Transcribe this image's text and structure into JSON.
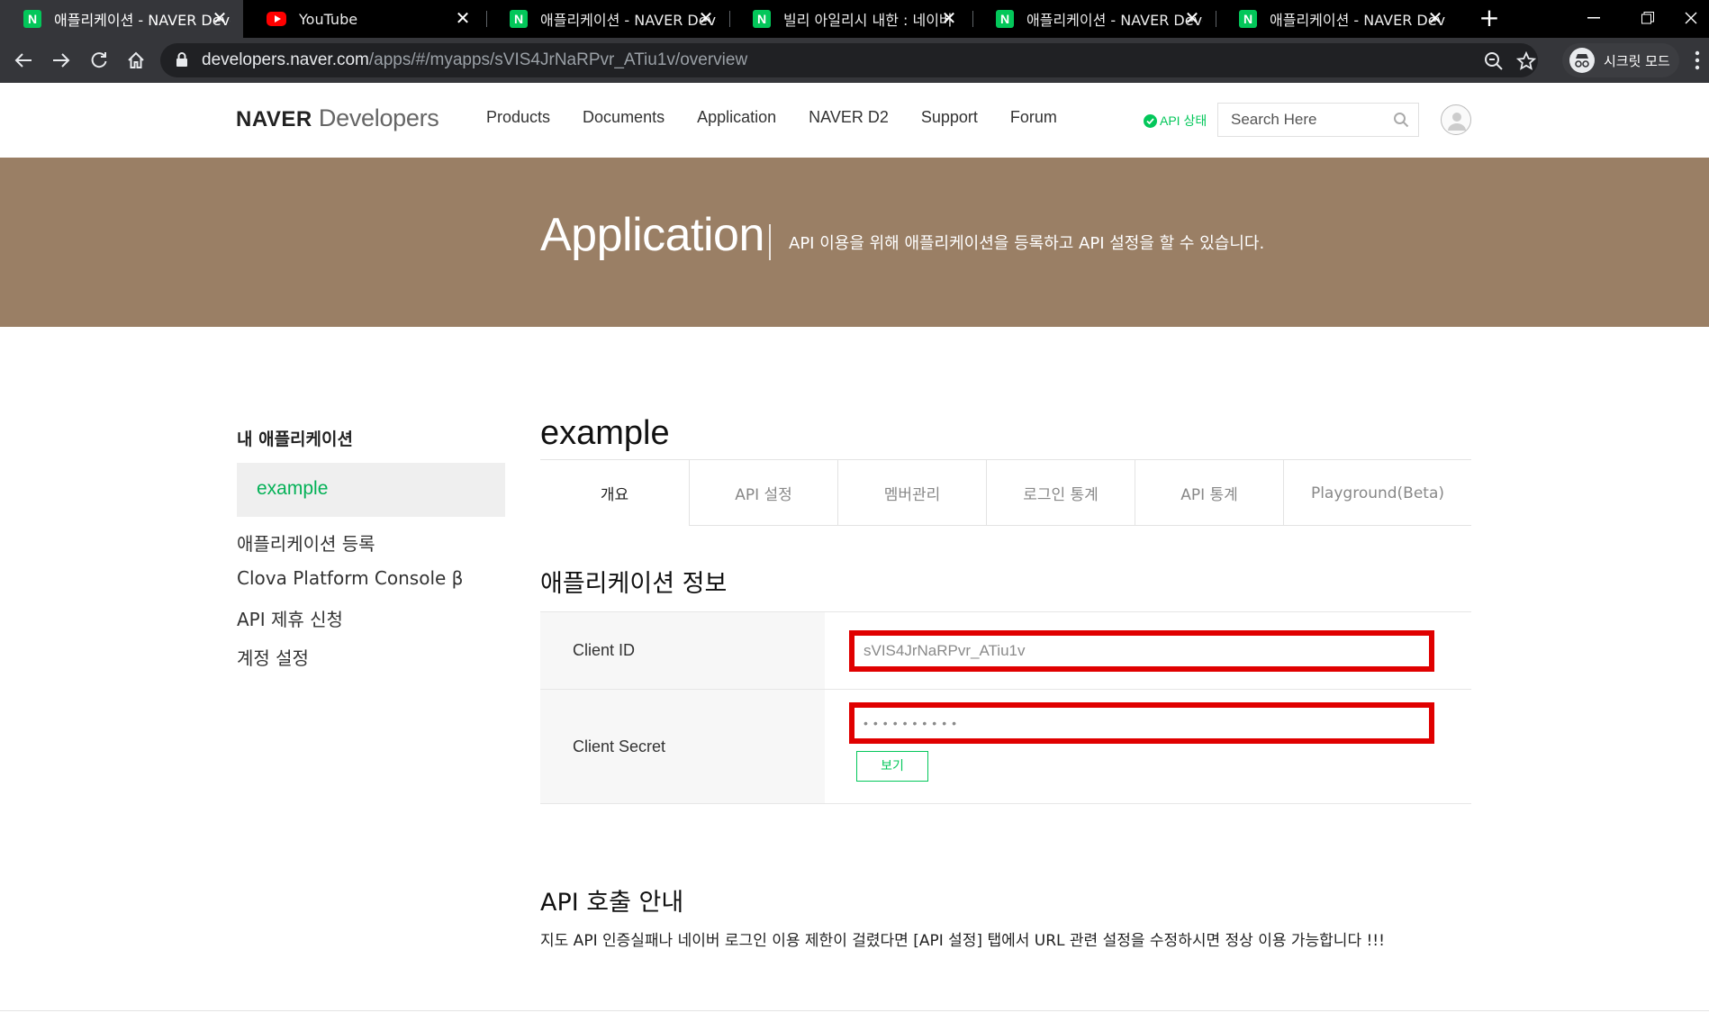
{
  "browser": {
    "tabs": [
      {
        "title": "애플리케이션 - NAVER Developers",
        "favicon": "naver-icon",
        "active": true
      },
      {
        "title": "YouTube",
        "favicon": "youtube-icon",
        "active": false
      },
      {
        "title": "애플리케이션 - NAVER Developers",
        "favicon": "naver-icon",
        "active": false
      },
      {
        "title": "빌리 아일리시 내한 : 네이버",
        "favicon": "naver-icon",
        "active": false
      },
      {
        "title": "애플리케이션 - NAVER Developers",
        "favicon": "naver-icon",
        "active": false
      },
      {
        "title": "애플리케이션 - NAVER Developers",
        "favicon": "naver-icon",
        "active": false
      }
    ],
    "url_host": "developers.naver.com",
    "url_path": "/apps/#/myapps/sVIS4JrNaRPvr_ATiu1v/overview",
    "incognito_label": "시크릿 모드",
    "new_tab_symbol": "+"
  },
  "header": {
    "logo_bold": "NAVER",
    "logo_light": " Developers",
    "nav": [
      "Products",
      "Documents",
      "Application",
      "NAVER D2",
      "Support",
      "Forum"
    ],
    "api_status": "API 상태",
    "search_placeholder": "Search Here"
  },
  "banner": {
    "title": "Application",
    "description": "API 이용을 위해 애플리케이션을 등록하고 API 설정을 할 수 있습니다."
  },
  "sidebar": {
    "title": "내 애플리케이션",
    "active_app": "example",
    "links": [
      "애플리케이션 등록",
      "Clova Platform Console β",
      "API 제휴 신청",
      "계정 설정"
    ]
  },
  "main": {
    "app_name": "example",
    "tabs": [
      "개요",
      "API 설정",
      "멤버관리",
      "로그인 통계",
      "API 통계",
      "Playground(Beta)"
    ],
    "active_tab": "개요",
    "info_title": "애플리케이션 정보",
    "client_id_label": "Client ID",
    "client_id_value": "sVIS4JrNaRPvr_ATiu1v",
    "client_secret_label": "Client Secret",
    "client_secret_value": "••••••••••",
    "view_button": "보기",
    "api_call_title": "API 호출 안내",
    "api_call_desc": "지도 API 인증실패나 네이버 로그인 이용 제한이 걸렸다면 [API 설정] 탭에서 URL 관련 설정을 수정하시면 정상 이용 가능합니다 !!!"
  },
  "colors": {
    "banner": "#9a7f65",
    "naver_green": "#03c75a",
    "highlight_red": "#e00000"
  }
}
